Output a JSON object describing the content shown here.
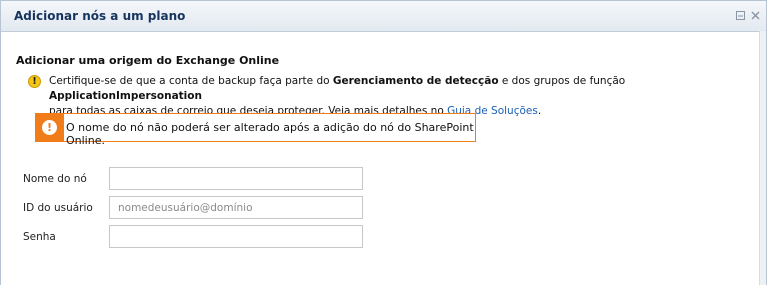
{
  "dialog": {
    "title": "Adicionar nós a um plano"
  },
  "section": {
    "heading": "Adicionar uma origem do Exchange Online"
  },
  "warning": {
    "text_1": "Certifique-se de que a conta de backup faça parte do ",
    "bold_1": "Gerenciamento de detecção",
    "text_2": " e dos grupos de função ",
    "bold_2": "ApplicationImpersonation",
    "text_3": "para todas as caixas de correio que deseja proteger. Veja mais detalhes no ",
    "link": "Guia de Soluções",
    "text_4": "."
  },
  "notice": {
    "text": "O nome do nó não poderá ser alterado após a adição do nó do SharePoint Online."
  },
  "form": {
    "node_name": {
      "label": "Nome do nó",
      "value": "",
      "placeholder": ""
    },
    "user_id": {
      "label": "ID do usuário",
      "value": "",
      "placeholder": "nomedeusuário@domínio"
    },
    "password": {
      "label": "Senha",
      "value": "",
      "placeholder": ""
    }
  },
  "icons": {
    "warning": "warning-icon",
    "notice": "exclamation-icon",
    "minimize": "minimize-icon",
    "close": "close-icon"
  },
  "colors": {
    "title": "#17345f",
    "notice_accent": "#f07c1a",
    "link": "#1a5fb4",
    "warning_icon": "#f5c518"
  }
}
